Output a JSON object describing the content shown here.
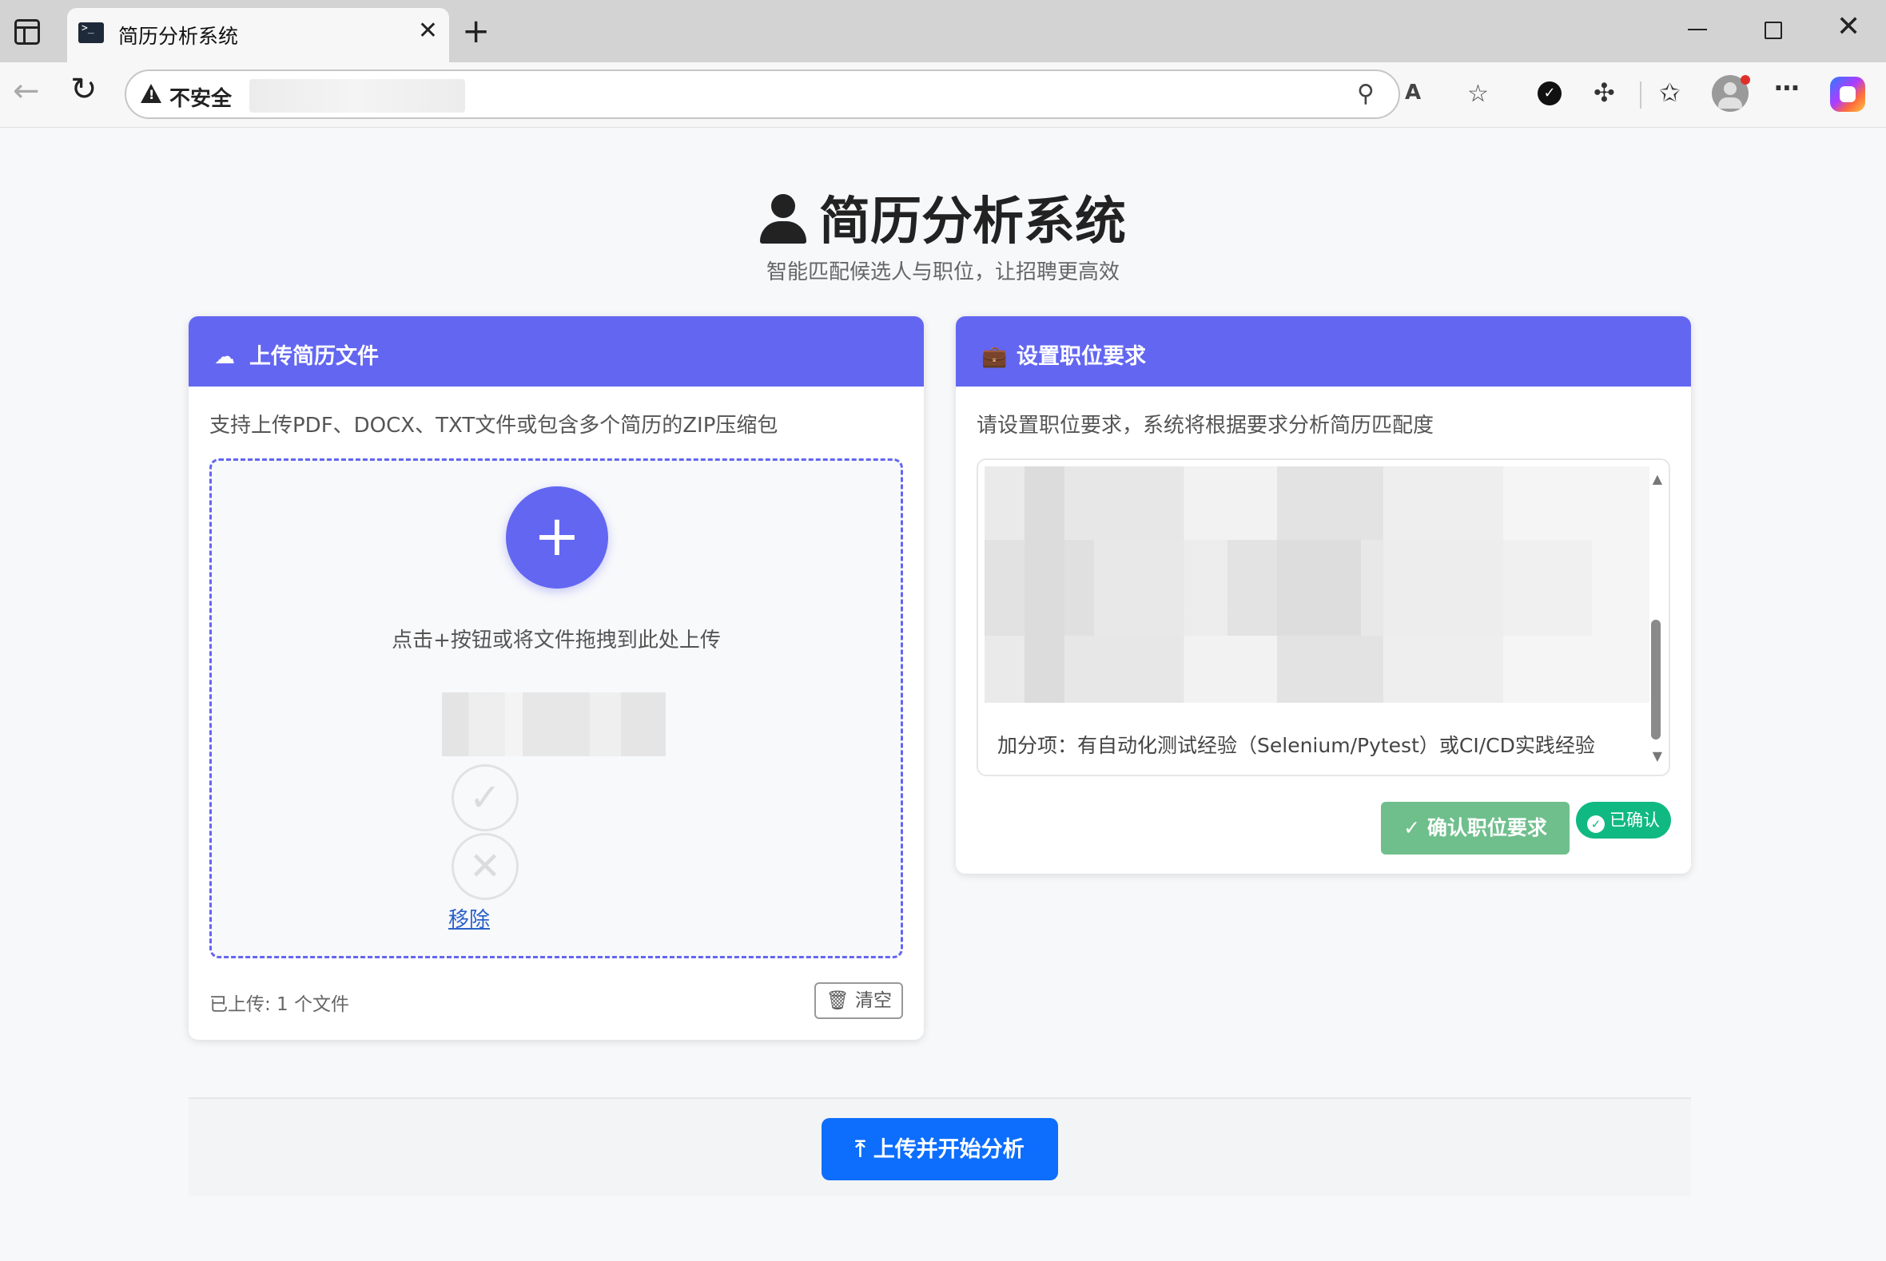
{
  "browser": {
    "tab_title": "简历分析系统",
    "insecure_label": "不安全",
    "new_tab_symbol": "+"
  },
  "header": {
    "title": "简历分析系统",
    "subtitle": "智能匹配候选人与职位，让招聘更高效"
  },
  "upload_card": {
    "title": "上传简历文件",
    "description": "支持上传PDF、DOCX、TXT文件或包含多个简历的ZIP压缩包",
    "drop_hint": "点击+按钮或将文件拖拽到此处上传",
    "add_symbol": "+",
    "remove_label": "移除",
    "uploaded_count": "已上传: 1 个文件",
    "clear_label": "清空"
  },
  "job_card": {
    "title": "设置职位要求",
    "description": "请设置职位要求，系统将根据要求分析简历匹配度",
    "visible_line": "加分项：有自动化测试经验（Selenium/Pytest）或CI/CD实践经验",
    "confirm_label": "确认职位要求",
    "confirmed_label": "已确认"
  },
  "actions": {
    "analyze_label": "上传并开始分析"
  },
  "colors": {
    "accent": "#6366f1",
    "primary_button": "#0d6efd",
    "success": "#10b981",
    "confirm_button": "#6fbf8c"
  },
  "icons": {
    "title": "user-tie-icon",
    "upload_header": "cloud-upload-icon",
    "job_header": "briefcase-icon",
    "clear": "trash-icon",
    "analyze": "upload-icon"
  }
}
